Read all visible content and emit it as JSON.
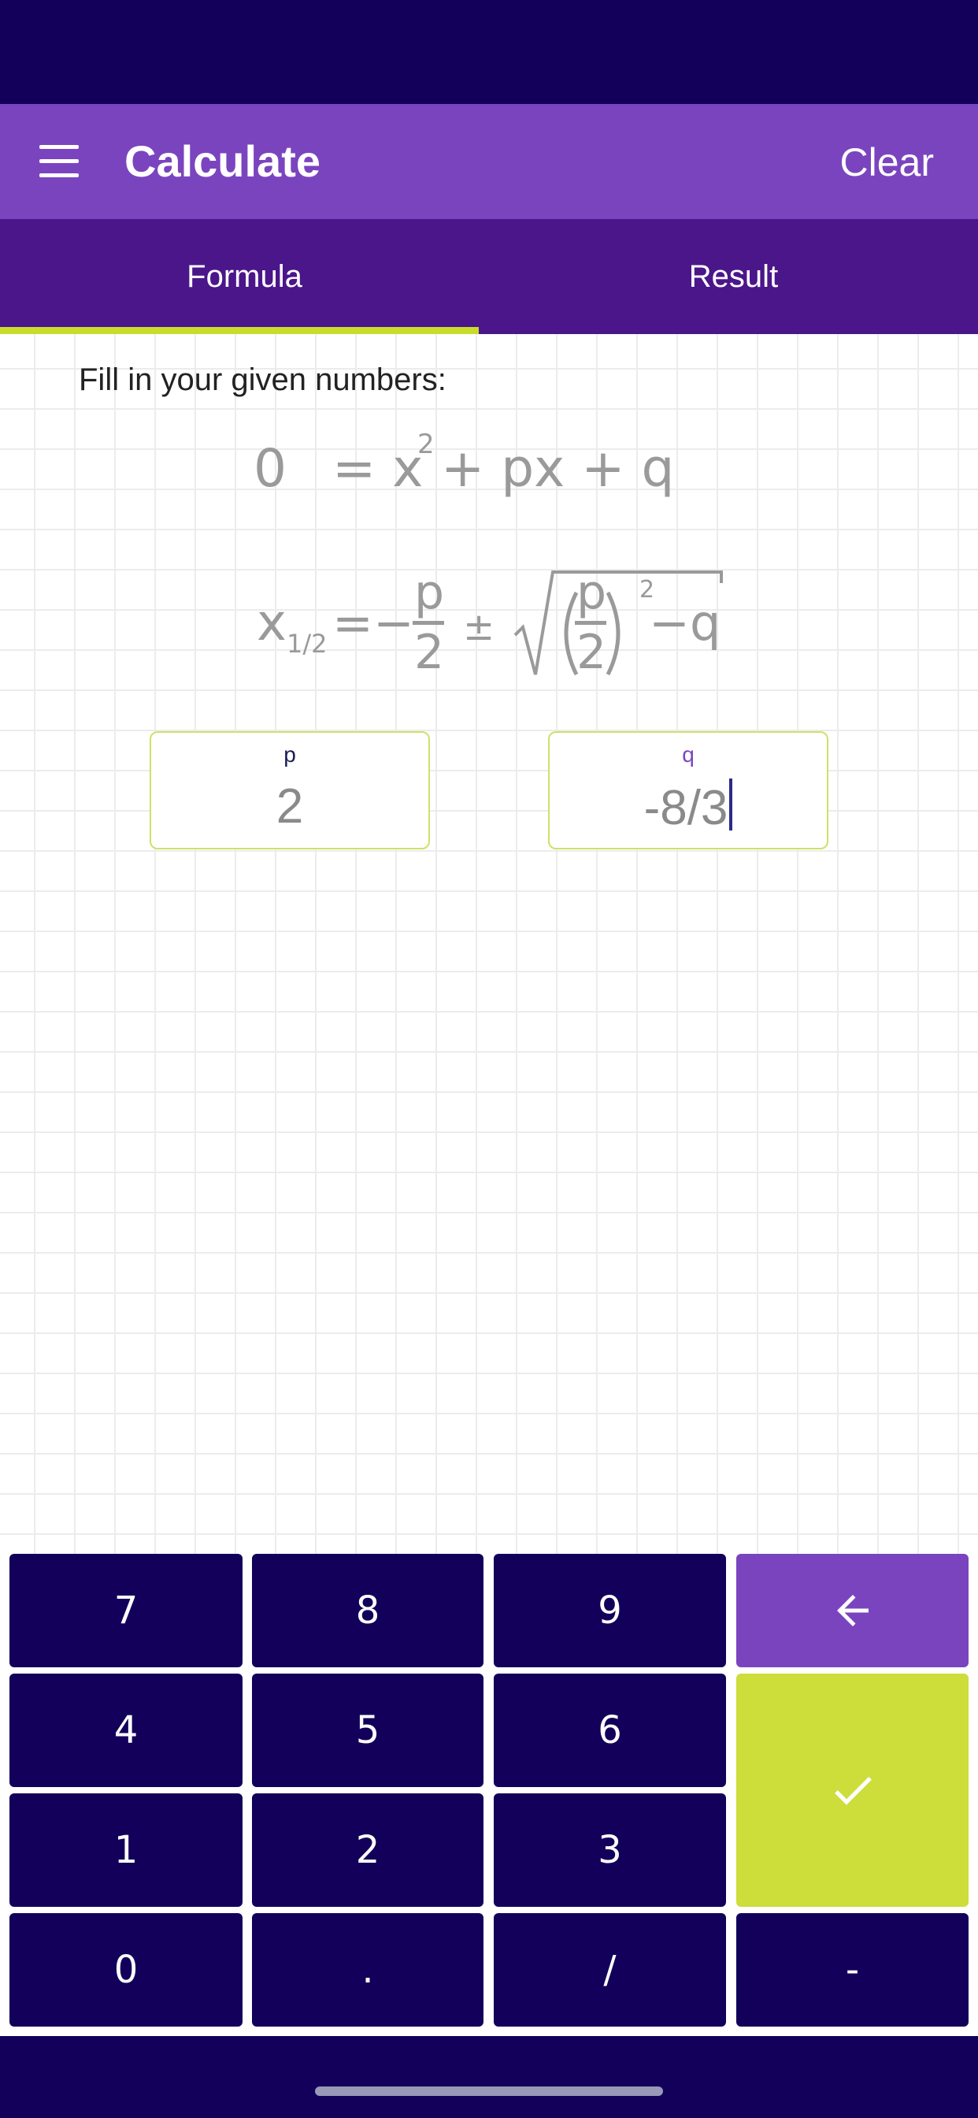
{
  "app_bar": {
    "title": "Calculate",
    "clear_label": "Clear"
  },
  "tabs": [
    {
      "label": "Formula",
      "selected": true
    },
    {
      "label": "Result",
      "selected": false
    }
  ],
  "content": {
    "instruction": "Fill in your given numbers:",
    "formula_line1": {
      "lhs": "0",
      "rhs_start": "= x",
      "exponent": "2",
      "rhs_end": "+ px + q"
    },
    "formula_line2": {
      "x": "x",
      "subscript": "1/2",
      "equals_minus": "=−",
      "p": "p",
      "two": "2",
      "pm": "±",
      "exponent": "2",
      "minus_q": "−q"
    }
  },
  "inputs": {
    "p": {
      "label": "p",
      "value": "2"
    },
    "q": {
      "label": "q",
      "value": "-8/3",
      "focused": true
    }
  },
  "keypad": {
    "keys": [
      "7",
      "8",
      "9",
      "4",
      "5",
      "6",
      "1",
      "2",
      "3",
      "0",
      ".",
      "/",
      "-"
    ],
    "backspace_icon": "arrow-left-icon",
    "confirm_icon": "check-icon"
  },
  "colors": {
    "status_bar": "#12005a",
    "app_bar": "#7b44bf",
    "tab_bar": "#4b168a",
    "tab_indicator": "#c8dc2a",
    "key": "#12005a",
    "key_backspace": "#7b44bf",
    "key_confirm": "#cddd3a"
  }
}
